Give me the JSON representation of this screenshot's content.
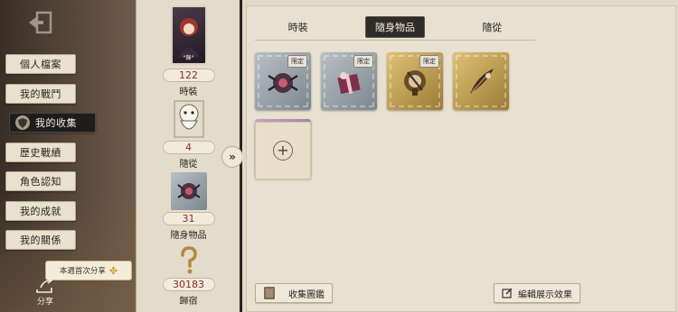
{
  "sidebar": {
    "menu": [
      {
        "label": "個人檔案"
      },
      {
        "label": "我的戰鬥"
      },
      {
        "label": "我的收集"
      },
      {
        "label": "歷史戰績"
      },
      {
        "label": "角色認知"
      },
      {
        "label": "我的成就"
      },
      {
        "label": "我的關係"
      }
    ],
    "share_banner": "本週首次分享",
    "share_label": "分享"
  },
  "stats": {
    "costume": {
      "count": "122",
      "label": "時裝",
      "card_tag": "\"錄\""
    },
    "pet": {
      "count": "4",
      "label": "隨從"
    },
    "accessory": {
      "count": "31",
      "label": "隨身物品"
    },
    "home": {
      "count": "30183",
      "label": "歸宿"
    }
  },
  "tabs": [
    {
      "label": "時裝"
    },
    {
      "label": "隨身物品"
    },
    {
      "label": "隨從"
    }
  ],
  "items": [
    {
      "type": "silver",
      "tag": "限定",
      "icon": "spider-doll-icon"
    },
    {
      "type": "silver",
      "tag": "限定",
      "icon": "gift-box-icon"
    },
    {
      "type": "gold",
      "tag": "限定",
      "icon": "machine-icon"
    },
    {
      "type": "gold",
      "tag": "",
      "icon": "feather-icon"
    },
    {
      "type": "purple",
      "tag": "",
      "icon": "ghost-icon"
    }
  ],
  "buttons": {
    "collection": "收集圖鑑",
    "edit": "編輯展示效果"
  }
}
